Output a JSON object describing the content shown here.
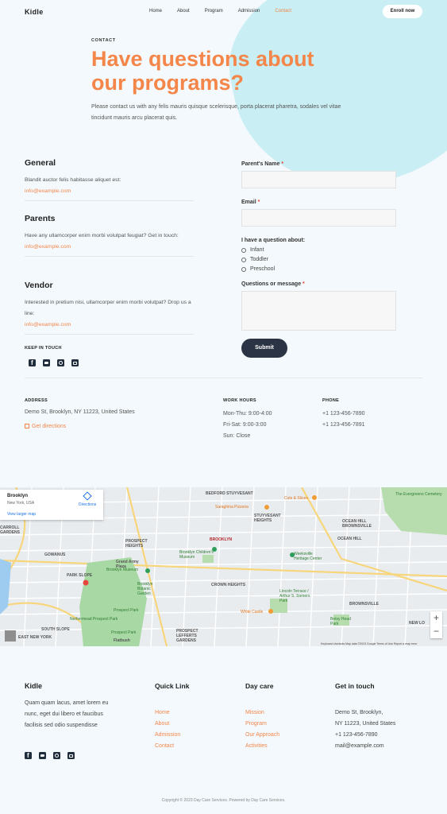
{
  "header": {
    "logo": "Kidle",
    "nav": [
      "Home",
      "About",
      "Program",
      "Admission",
      "Contact"
    ],
    "active_nav": "Contact",
    "enroll_label": "Enroll now"
  },
  "hero": {
    "kicker": "CONTACT",
    "title": "Have questions about our programs?",
    "description": "Please contact us with any felis mauris quisque scelerisque, porta placerat pharetra, sodales vel vitae tincidunt mauris arcu placerat quis."
  },
  "contacts": [
    {
      "title": "General",
      "text": "Blandit auctor felis habitasse aliquet est:",
      "email": "info@example.com"
    },
    {
      "title": "Parents",
      "text": "Have any ullamcorper enim morbi volutpat feugiat? Get in touch:",
      "email": "info@example.com"
    },
    {
      "title": "Vendor",
      "text": "Interested in pretium nisi, ullamcorper enim morbi volutpat? Drop us a line:",
      "email": "info@example.com"
    }
  ],
  "keep_in_touch": "KEEP IN TOUCH",
  "socials": [
    "facebook-icon",
    "twitter-icon",
    "instagram-icon",
    "youtube-icon"
  ],
  "form": {
    "name_label": "Parent's Name",
    "email_label": "Email",
    "question_label": "I have a question about:",
    "options": [
      "Infant",
      "Toddler",
      "Preschool"
    ],
    "message_label": "Questions or message",
    "required_mark": "*",
    "submit_label": "Submit"
  },
  "info": {
    "address_heading": "ADDRESS",
    "address": "Demo St, Brooklyn, NY 11223, United States",
    "directions": "Get directions",
    "hours_heading": "WORK HOURS",
    "hours": [
      "Mon-Thu: 9:00-4:00",
      "Fri-Sat: 9:00-3:00",
      "Sun: Close"
    ],
    "phone_heading": "PHONE",
    "phones": [
      "+1 123-456-7890",
      "+1 123-456-7891"
    ]
  },
  "map": {
    "place": "Brooklyn",
    "region": "New York, USA",
    "directions": "Directions",
    "larger_map": "View larger map",
    "labels": {
      "brooklyn": "BROOKLYN",
      "stuyvesant": "STUYVESANT HEIGHTS",
      "bedford": "BEDFORD STUYVESANT",
      "prospect_heights": "PROSPECT HEIGHTS",
      "crown_heights": "CROWN HEIGHTS",
      "park_slope": "PARK SLOPE",
      "gowanus": "GOWANUS",
      "ocean_hill": "OCEAN HILL",
      "brownsville": "BROWNSVILLE",
      "east_new_york": "EAST NEW YORK",
      "south_slope": "SOUTH SLOPE",
      "prospect_lefferts": "PROSPECT LEFFERTS GARDENS",
      "carroll_gardens": "CARROLL GARDENS",
      "museum": "Brooklyn Children's Museum",
      "weeksville": "Weeksville Heritage Center",
      "pizzeria": "Saraghina Pizzeria",
      "cuts": "Cuts & Slices",
      "evergreens": "The Evergreens Cemetery",
      "botanic": "Brooklyn Botanic Garden",
      "prospect_park": "Prospect Park",
      "white_castle": "White Castle",
      "lincoln": "Lincoln Terrace / Arthur S. Somers Park",
      "betsy": "Betsy Head Park",
      "brooklyn_museum": "Brooklyn Museum",
      "grand_army": "Grand Army Plaza",
      "nethermead": "Nethermead Prospect Park",
      "flatbush": "Flatbush",
      "prospect_park_2": "Prospect Park",
      "ocean_hill_brownsville": "OCEAN HILL BROWNSVILLE",
      "new_lo": "NEW LO"
    },
    "footer_text": "Keyboard shortcuts  Map data ©2023 Google  Terms of Use  Report a map error",
    "zoom_in": "+",
    "zoom_out": "−"
  },
  "footer": {
    "logo": "Kidle",
    "description": "Quam quam lacus, amet lorem eu nunc, eget dui libero et faucibus facilisis sed odio suspendisse",
    "quick_link_heading": "Quick Link",
    "quick_links": [
      "Home",
      "About",
      "Admission",
      "Contact"
    ],
    "daycare_heading": "Day care",
    "daycare_links": [
      "Mission",
      "Program",
      "Our Approach",
      "Activities"
    ],
    "touch_heading": "Get in touch",
    "touch_lines": [
      "Demo St, Brooklyn,",
      "NY 11223, United States",
      "+1 123-456-7890",
      "mail@example.com"
    ],
    "copyright": "Copyright © 2023 Day Care Services. Powered by Day Care Services."
  },
  "colors": {
    "accent": "#f4864a",
    "dark": "#2b3444",
    "background": "#f3f9fc",
    "blob": "#c9eef3"
  }
}
